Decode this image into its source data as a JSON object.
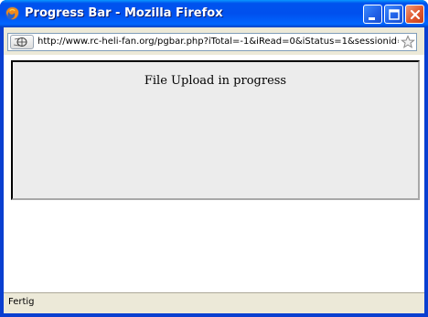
{
  "window": {
    "title": "Progress Bar - Mozilla Firefox",
    "minimize_icon": "minimize-icon",
    "maximize_icon": "maximize-icon",
    "close_icon": "close-icon",
    "app_icon": "firefox-icon"
  },
  "address_bar": {
    "url": "http://www.rc-heli-fan.org/pgbar.php?iTotal=-1&iRead=0&iStatus=1&sessionid=",
    "site_icon": "site-identity-icon",
    "bookmark_icon": "star-icon"
  },
  "content": {
    "message": "File Upload in progress"
  },
  "status_bar": {
    "text": "Fertig"
  },
  "colors": {
    "titlebar": "#0050ee",
    "chrome": "#ece9d8",
    "panel": "#ececec"
  }
}
